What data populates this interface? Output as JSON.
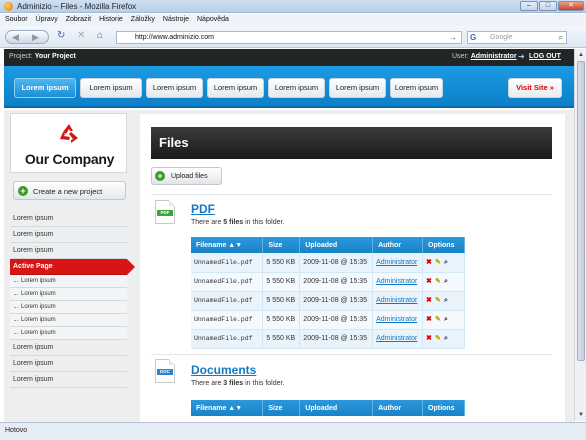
{
  "window": {
    "title": "Adminizio – Files - Mozilla Firefox"
  },
  "menubar": [
    "Soubor",
    "Úpravy",
    "Zobrazit",
    "Historie",
    "Záložky",
    "Nástroje",
    "Nápověda"
  ],
  "nav": {
    "url": "http://www.adminizio.com",
    "search_placeholder": "Google"
  },
  "topbar": {
    "project_label": "Project:",
    "project_name": "Your Project",
    "user_label": "User:",
    "user_name": "Administrator",
    "logout": "LOG OUT"
  },
  "tabs": [
    "Lorem ipsum",
    "Lorem ipsum",
    "Lorem ipsum",
    "Lorem ipsum",
    "Lorem ipsum",
    "Lorem ipsum",
    "Lorem ipsum"
  ],
  "visit_site": "Visit Site »",
  "sidebar": {
    "company": "Our Company",
    "create_project": "Create a new project",
    "items": [
      {
        "label": "Lorem ipsum",
        "type": "item"
      },
      {
        "label": "Lorem ipsum",
        "type": "item"
      },
      {
        "label": "Lorem ipsum",
        "type": "item"
      },
      {
        "label": "Active Page",
        "type": "active"
      },
      {
        "label": "Lorem ipsum",
        "type": "sub"
      },
      {
        "label": "Lorem ipsum",
        "type": "sub"
      },
      {
        "label": "Lorem ipsum",
        "type": "sub"
      },
      {
        "label": "Lorem ipsum",
        "type": "sub"
      },
      {
        "label": "Lorem ipsum",
        "type": "sub"
      },
      {
        "label": "Lorem ipsum",
        "type": "item"
      },
      {
        "label": "Lorem ipsum",
        "type": "item"
      },
      {
        "label": "Lorem ipsum",
        "type": "item"
      }
    ]
  },
  "page": {
    "title": "Files",
    "upload": "Upload files",
    "columns": [
      "Filename ▲▼",
      "Size",
      "Uploaded",
      "Author",
      "Options"
    ],
    "folders": [
      {
        "name": "PDF",
        "type_tag": "PDF",
        "tag_color": "#3fa43a",
        "count_pre": "There are ",
        "count": "5 files",
        "count_post": " in this folder.",
        "rows": [
          {
            "filename": "UnnamedFile.pdf",
            "size": "5 550 KB",
            "uploaded": "2009-11-08 @ 15:35",
            "author": "Administrator"
          },
          {
            "filename": "UnnamedFile.pdf",
            "size": "5 550 KB",
            "uploaded": "2009-11-08 @ 15:35",
            "author": "Administrator"
          },
          {
            "filename": "UnnamedFile.pdf",
            "size": "5 550 KB",
            "uploaded": "2009-11-08 @ 15:35",
            "author": "Administrator"
          },
          {
            "filename": "UnnamedFile.pdf",
            "size": "5 550 KB",
            "uploaded": "2009-11-08 @ 15:35",
            "author": "Administrator"
          },
          {
            "filename": "UnnamedFile.pdf",
            "size": "5 550 KB",
            "uploaded": "2009-11-08 @ 15:35",
            "author": "Administrator"
          }
        ]
      },
      {
        "name": "Documents",
        "type_tag": "DOC",
        "tag_color": "#2a86d1",
        "count_pre": "There are ",
        "count": "3 files",
        "count_post": " in this folder.",
        "rows": []
      }
    ]
  },
  "status": "Hotovo",
  "colors": {
    "accent": "#1a8fd6",
    "active": "#d81414",
    "topbar": "#222526"
  }
}
